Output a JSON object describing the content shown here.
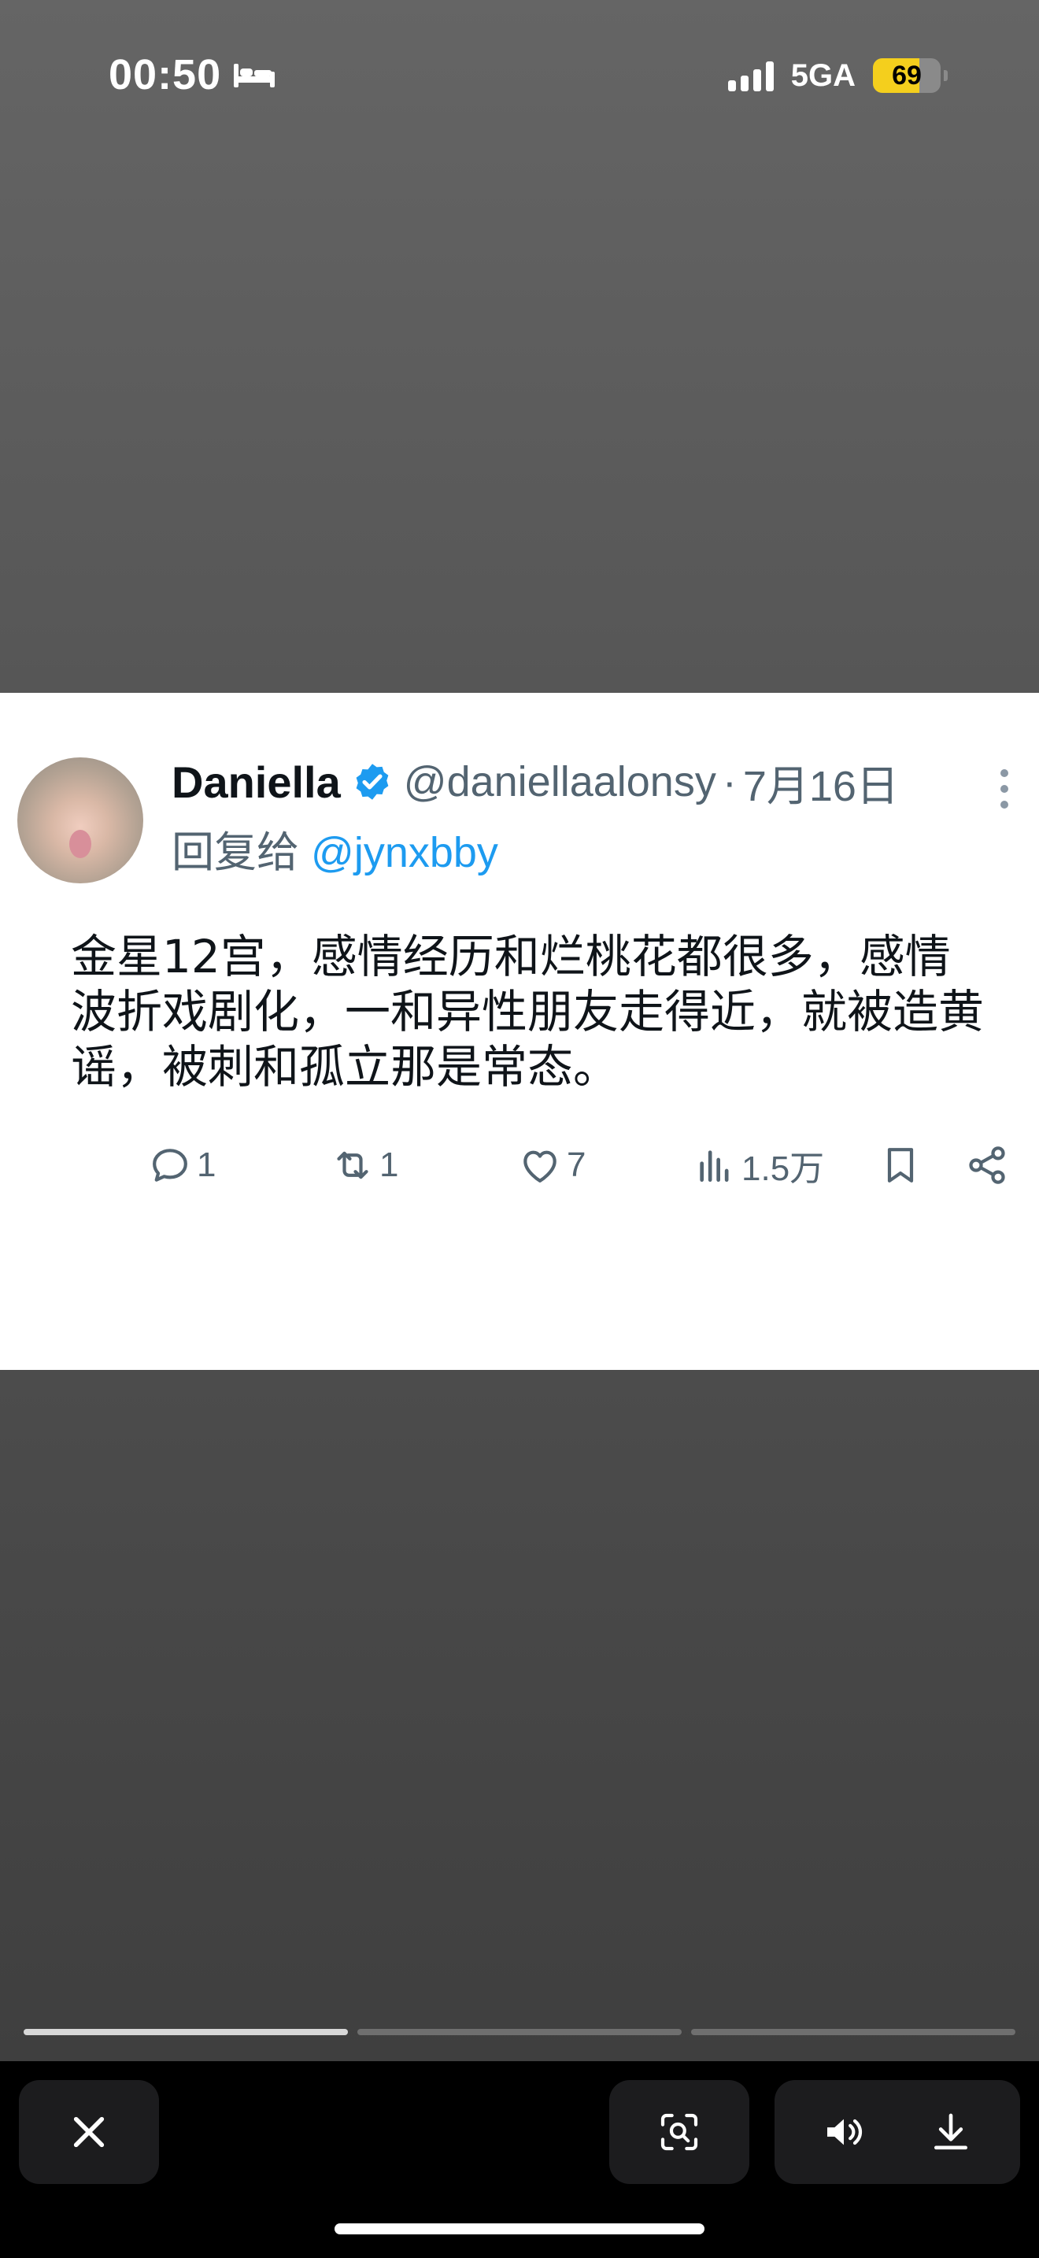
{
  "status_bar": {
    "time": "00:50",
    "network": "5GA",
    "battery_level": "69",
    "battery_fraction": 0.69,
    "battery_color": "#f4cf1d",
    "icons": [
      "bed-icon",
      "signal-icon"
    ]
  },
  "tweet": {
    "display_name": "Daniella",
    "verified_color": "#1d9bf0",
    "handle": "@daniellaalonsy",
    "separator": "·",
    "date": "7月16日",
    "reply_prefix": "回复给",
    "reply_to": "@jynxbby",
    "text": "金星12宫，感情经历和烂桃花都很多，感情波折戏剧化，一和异性朋友走得近，就被造黄谣，被刺和孤立那是常态。",
    "stats": {
      "replies": "1",
      "reposts": "1",
      "likes": "7",
      "views": "1.5万"
    }
  },
  "story_progress": {
    "segments": 3,
    "current_segment_fill": 1.0
  },
  "bottom_bar": {
    "buttons": [
      "close-icon",
      "scan-icon",
      "speaker-icon",
      "download-icon"
    ]
  }
}
